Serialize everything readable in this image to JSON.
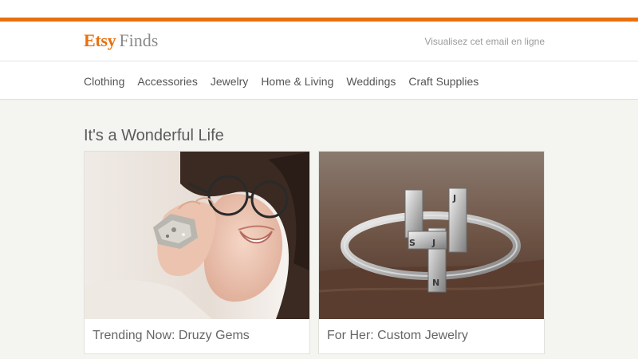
{
  "header": {
    "logo_brand": "Etsy",
    "logo_suffix": "Finds",
    "view_online": "Visualisez cet email en ligne"
  },
  "nav": {
    "items": [
      "Clothing",
      "Accessories",
      "Jewelry",
      "Home & Living",
      "Weddings",
      "Craft Supplies"
    ]
  },
  "main": {
    "title": "It's a Wonderful Life",
    "cards": [
      {
        "caption": "Trending Now: Druzy Gems",
        "image": "woman-with-druzy-ring-photo"
      },
      {
        "caption": "For Her: Custom Jewelry",
        "image": "custom-initial-ring-photo"
      }
    ]
  },
  "colors": {
    "accent": "#e8700f",
    "background": "#f4f4f1",
    "text": "#555555"
  }
}
